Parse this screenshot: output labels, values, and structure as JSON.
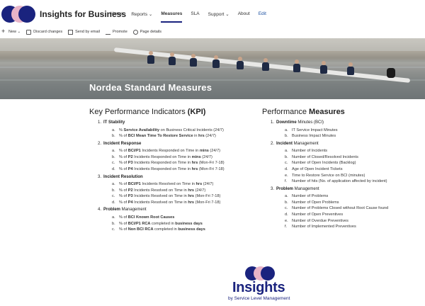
{
  "header": {
    "site_title": "Insights for Business",
    "nav": [
      {
        "label": "Home"
      },
      {
        "label": "Reports ⌄"
      },
      {
        "label": "Measures"
      },
      {
        "label": "SLA"
      },
      {
        "label": "Support ⌄"
      },
      {
        "label": "About"
      },
      {
        "label": "Edit"
      }
    ],
    "active_nav": "Measures",
    "accent_color": "#1a237e",
    "logo_secondary_color": "#e8b4c8"
  },
  "command_bar": {
    "items": [
      {
        "label": "New ⌄",
        "icon": "plus-icon"
      },
      {
        "label": "Discard changes",
        "icon": "discard-icon"
      },
      {
        "label": "Send by email",
        "icon": "mail-icon"
      },
      {
        "label": "Promote",
        "icon": "promote-icon"
      },
      {
        "label": "Page details",
        "icon": "gear-icon"
      }
    ]
  },
  "hero": {
    "title": "Nordea Standard Measures"
  },
  "kpi": {
    "heading_prefix": "Key Performance Indicators",
    "heading_suffix": "(KPI)",
    "sections": [
      {
        "num": "1.",
        "title_bold": "IT Stability",
        "title_rest": "",
        "items": [
          {
            "letter": "a.",
            "parts": [
              {
                "t": "% ",
                "b": false
              },
              {
                "t": "Service Availability",
                "b": true
              },
              {
                "t": " on Business Critical Incidents (24/7)",
                "b": false
              }
            ]
          },
          {
            "letter": "b.",
            "parts": [
              {
                "t": "% of ",
                "b": false
              },
              {
                "t": "BCI Mean Time To Restore Service",
                "b": true
              },
              {
                "t": " in ",
                "b": false
              },
              {
                "t": "hrs",
                "b": true
              },
              {
                "t": " (24/7)",
                "b": false
              }
            ]
          }
        ]
      },
      {
        "num": "2.",
        "title_bold": "Incident Response",
        "title_rest": "",
        "items": [
          {
            "letter": "a.",
            "parts": [
              {
                "t": "% of ",
                "b": false
              },
              {
                "t": "BCI/P1",
                "b": true
              },
              {
                "t": " Incidents Responded on Time in ",
                "b": false
              },
              {
                "t": "mins",
                "b": true
              },
              {
                "t": " (24/7)",
                "b": false
              }
            ]
          },
          {
            "letter": "b.",
            "parts": [
              {
                "t": "% of ",
                "b": false
              },
              {
                "t": "P2",
                "b": true
              },
              {
                "t": " Incidents Responded on Time in ",
                "b": false
              },
              {
                "t": "mins",
                "b": true
              },
              {
                "t": " (24/7)",
                "b": false
              }
            ]
          },
          {
            "letter": "c.",
            "parts": [
              {
                "t": "% of ",
                "b": false
              },
              {
                "t": "P3",
                "b": true
              },
              {
                "t": " Incidents Responded on Time in ",
                "b": false
              },
              {
                "t": "hrs",
                "b": true
              },
              {
                "t": " (Mon-Fri 7-18)",
                "b": false
              }
            ]
          },
          {
            "letter": "d.",
            "parts": [
              {
                "t": "% of ",
                "b": false
              },
              {
                "t": "P4",
                "b": true
              },
              {
                "t": " Incidents Responded on Time in ",
                "b": false
              },
              {
                "t": "hrs",
                "b": true
              },
              {
                "t": " (Mon-Fri 7-18)",
                "b": false
              }
            ]
          }
        ]
      },
      {
        "num": "3.",
        "title_bold": "Incident Resolution",
        "title_rest": "",
        "items": [
          {
            "letter": "a.",
            "parts": [
              {
                "t": "% of ",
                "b": false
              },
              {
                "t": "BCI/P1",
                "b": true
              },
              {
                "t": " Incidents Resolved on Time in ",
                "b": false
              },
              {
                "t": "hrs",
                "b": true
              },
              {
                "t": " (24/7)",
                "b": false
              }
            ]
          },
          {
            "letter": "b.",
            "parts": [
              {
                "t": "% of ",
                "b": false
              },
              {
                "t": "P2",
                "b": true
              },
              {
                "t": " Incidents Resolved on Time in ",
                "b": false
              },
              {
                "t": "hrs",
                "b": true
              },
              {
                "t": " (24/7)",
                "b": false
              }
            ]
          },
          {
            "letter": "c.",
            "parts": [
              {
                "t": "% of ",
                "b": false
              },
              {
                "t": "P3",
                "b": true
              },
              {
                "t": " Incidents Resolved on Time in ",
                "b": false
              },
              {
                "t": "hrs",
                "b": true
              },
              {
                "t": " (Mon-Fri 7-18)",
                "b": false
              }
            ]
          },
          {
            "letter": "d.",
            "parts": [
              {
                "t": "% of ",
                "b": false
              },
              {
                "t": "P4",
                "b": true
              },
              {
                "t": " Incidents Resolved on Time in ",
                "b": false
              },
              {
                "t": "hrs",
                "b": true
              },
              {
                "t": " (Mon-Fri 7-18)",
                "b": false
              }
            ]
          }
        ]
      },
      {
        "num": "4.",
        "title_bold": "Problem",
        "title_rest": " Management",
        "items": [
          {
            "letter": "a.",
            "parts": [
              {
                "t": "% of ",
                "b": false
              },
              {
                "t": "BCI Known Root Causes",
                "b": true
              }
            ]
          },
          {
            "letter": "b.",
            "parts": [
              {
                "t": "% of ",
                "b": false
              },
              {
                "t": "BCI/P1 RCA",
                "b": true
              },
              {
                "t": " completed in ",
                "b": false
              },
              {
                "t": "business days",
                "b": true
              }
            ]
          },
          {
            "letter": "c.",
            "parts": [
              {
                "t": "% of ",
                "b": false
              },
              {
                "t": "Non BCI RCA",
                "b": true
              },
              {
                "t": " completed in ",
                "b": false
              },
              {
                "t": "business days",
                "b": true
              }
            ]
          }
        ]
      }
    ]
  },
  "pm": {
    "heading_prefix": "Performance",
    "heading_suffix": "Measures",
    "sections": [
      {
        "num": "1.",
        "title_bold": "Downtime",
        "title_rest": " Minutes (BCI)",
        "items": [
          {
            "letter": "a.",
            "parts": [
              {
                "t": "IT Service Impact Minutes",
                "b": false
              }
            ]
          },
          {
            "letter": "b.",
            "parts": [
              {
                "t": "Business Impact Minutes",
                "b": false
              }
            ]
          }
        ]
      },
      {
        "num": "2.",
        "title_bold": "Incident",
        "title_rest": " Management",
        "items": [
          {
            "letter": "a.",
            "parts": [
              {
                "t": "Number of Incidents",
                "b": false
              }
            ]
          },
          {
            "letter": "b.",
            "parts": [
              {
                "t": "Number of Closed/Resolved Incidents",
                "b": false
              }
            ]
          },
          {
            "letter": "c.",
            "parts": [
              {
                "t": "Number of Open Incidents (Backlog)",
                "b": false
              }
            ]
          },
          {
            "letter": "d.",
            "parts": [
              {
                "t": "Age of Open Incident Tickets",
                "b": false
              }
            ]
          },
          {
            "letter": "e.",
            "parts": [
              {
                "t": "Time to Restore Service on BCI (minutes)",
                "b": false
              }
            ]
          },
          {
            "letter": "f.",
            "parts": [
              {
                "t": "Number of hits (No. of application affected by incident)",
                "b": false
              }
            ]
          }
        ]
      },
      {
        "num": "3.",
        "title_bold": "Problem",
        "title_rest": " Management",
        "items": [
          {
            "letter": "a.",
            "parts": [
              {
                "t": "Number of Problems",
                "b": false
              }
            ]
          },
          {
            "letter": "b.",
            "parts": [
              {
                "t": "Number of Open Problems",
                "b": false
              }
            ]
          },
          {
            "letter": "c.",
            "parts": [
              {
                "t": "Number of Problems Closed without Root Cause found",
                "b": false
              }
            ]
          },
          {
            "letter": "d.",
            "parts": [
              {
                "t": "Number of Open Preventives",
                "b": false
              }
            ]
          },
          {
            "letter": "e.",
            "parts": [
              {
                "t": "Number of Overdue Preventives",
                "b": false
              }
            ]
          },
          {
            "letter": "f.",
            "parts": [
              {
                "t": "Number of Implemented Preventives",
                "b": false
              }
            ]
          }
        ]
      }
    ]
  },
  "footer_logo": {
    "brand": "Insights",
    "tagline": "by Service Level Management"
  }
}
